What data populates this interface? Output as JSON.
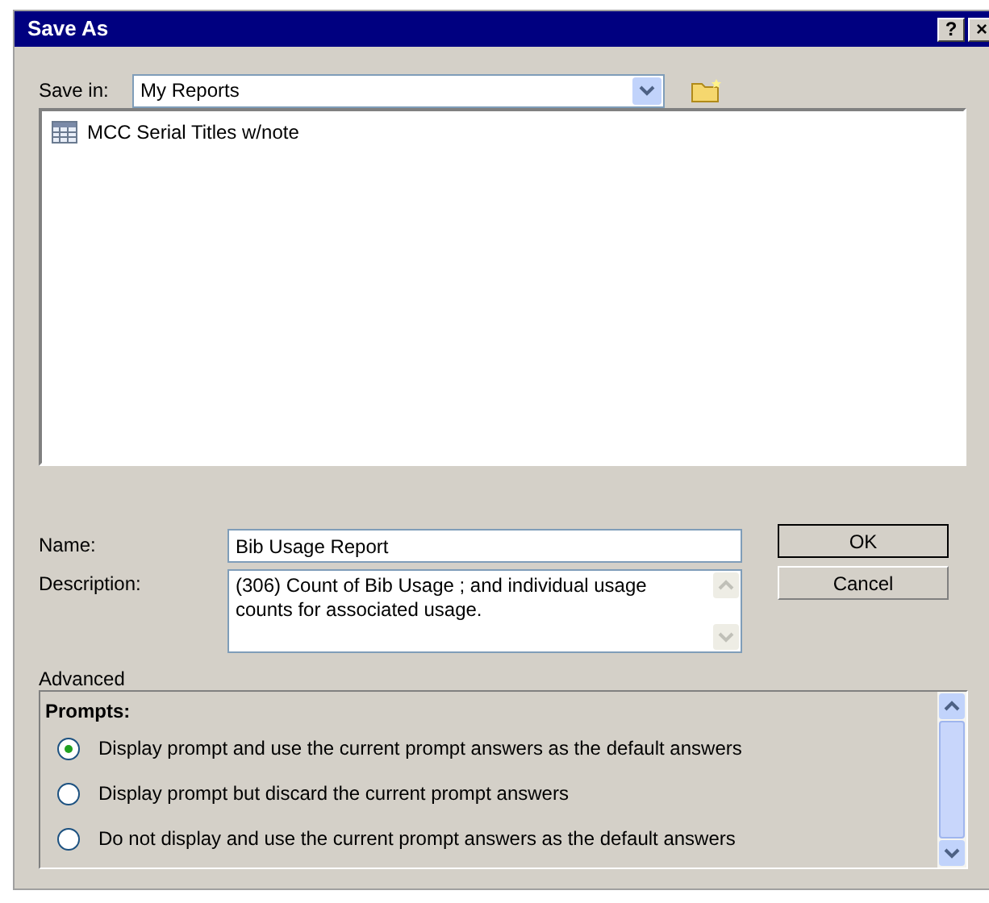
{
  "window": {
    "title": "Save As",
    "title_buttons": [
      "?",
      "×"
    ]
  },
  "save_in": {
    "label": "Save in:",
    "value": "My Reports"
  },
  "files": [
    {
      "name": "MCC Serial Titles w/note",
      "selected": false
    }
  ],
  "name_field": {
    "label": "Name:",
    "value": "Bib Usage Report"
  },
  "description_field": {
    "label": "Description:",
    "value": "(306) Count of Bib Usage ; and individual usage counts for associated usage."
  },
  "buttons": [
    {
      "label": "OK",
      "default": true
    },
    {
      "label": "Cancel",
      "default": false
    }
  ],
  "advanced": {
    "label": "Advanced",
    "heading": "Prompts:",
    "options": [
      {
        "label": "Display prompt and use the current prompt answers as the default answers",
        "selected": true
      },
      {
        "label": "Display prompt but discard the current prompt answers",
        "selected": false
      },
      {
        "label": "Do not display and use the current prompt answers as the default answers",
        "selected": false
      }
    ]
  }
}
